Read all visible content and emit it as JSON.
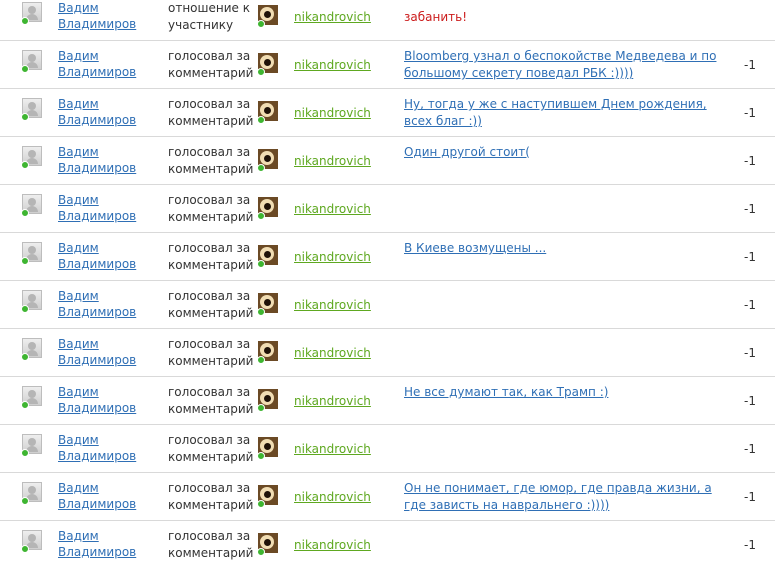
{
  "rows": [
    {
      "user": "Вадим Владимиров",
      "action": "отношение к участнику",
      "target_user": "nikandrovich",
      "content": "забанить!",
      "content_type": "text",
      "content_color": "#cc1d1d",
      "score": ""
    },
    {
      "user": "Вадим Владимиров",
      "action": "голосовал за комментарий",
      "target_user": "nikandrovich",
      "content": "Bloomberg узнал о беспокойстве Медведева и по большому секрету поведал РБК :))))",
      "content_type": "link",
      "score": "-1"
    },
    {
      "user": "Вадим Владимиров",
      "action": "голосовал за комментарий",
      "target_user": "nikandrovich",
      "content": "Ну, тогда у же с наступившем Днем рождения, всех благ :))",
      "content_type": "link",
      "score": "-1"
    },
    {
      "user": "Вадим Владимиров",
      "action": "голосовал за комментарий",
      "target_user": "nikandrovich",
      "content": "Один другой стоит(",
      "content_type": "link",
      "score": "-1"
    },
    {
      "user": "Вадим Владимиров",
      "action": "голосовал за комментарий",
      "target_user": "nikandrovich",
      "content": "",
      "content_type": "link",
      "score": "-1"
    },
    {
      "user": "Вадим Владимиров",
      "action": "голосовал за комментарий",
      "target_user": "nikandrovich",
      "content": "В Киеве возмущены ...",
      "content_type": "link",
      "score": "-1"
    },
    {
      "user": "Вадим Владимиров",
      "action": "голосовал за комментарий",
      "target_user": "nikandrovich",
      "content": "",
      "content_type": "link",
      "score": "-1"
    },
    {
      "user": "Вадим Владимиров",
      "action": "голосовал за комментарий",
      "target_user": "nikandrovich",
      "content": "",
      "content_type": "link",
      "score": "-1"
    },
    {
      "user": "Вадим Владимиров",
      "action": "голосовал за комментарий",
      "target_user": "nikandrovich",
      "content": "Не все думают так, как Трамп :)",
      "content_type": "link",
      "score": "-1"
    },
    {
      "user": "Вадим Владимиров",
      "action": "голосовал за комментарий",
      "target_user": "nikandrovich",
      "content": "",
      "content_type": "link",
      "score": "-1"
    },
    {
      "user": "Вадим Владимиров",
      "action": "голосовал за комментарий",
      "target_user": "nikandrovich",
      "content": "Он не понимает, где юмор,  где правда жизни, а где зависть на навральнего :))))",
      "content_type": "link",
      "score": "-1"
    },
    {
      "user": "Вадим Владимиров",
      "action": "голосовал за комментарий",
      "target_user": "nikandrovich",
      "content": "",
      "content_type": "link",
      "score": "-1"
    }
  ],
  "icons": {
    "user_avatar": "default-user-avatar-icon",
    "target_avatar": "user-photo-avatar",
    "online_indicator": "online-dot-icon"
  },
  "colors": {
    "link": "#2f6fb5",
    "username_green": "#5ea820",
    "ban_red": "#cc1d1d",
    "online": "#3eb531",
    "divider": "#d9d9d9"
  }
}
